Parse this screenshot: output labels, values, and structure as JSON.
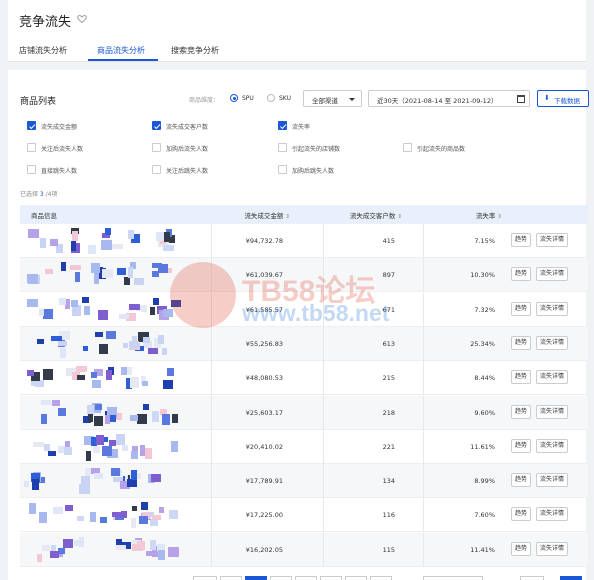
{
  "header": {
    "title": "竞争流失",
    "tabs": [
      {
        "label": "店铺流失分析",
        "active": false
      },
      {
        "label": "商品流失分析",
        "active": true
      },
      {
        "label": "搜索竞争分析",
        "active": false
      }
    ]
  },
  "list": {
    "title": "商品列表",
    "dimension_label": "商品维度：",
    "dimension_options": [
      {
        "label": "SPU",
        "selected": true
      },
      {
        "label": "SKU",
        "selected": false
      }
    ],
    "channel_select": "全部渠道",
    "date_range": "近30天（2021-08-14 至 2021-09-12）",
    "download_label": "下载数据"
  },
  "metrics": [
    {
      "label": "流失成交金额",
      "checked": true
    },
    {
      "label": "流失成交客户数",
      "checked": true
    },
    {
      "label": "流失率",
      "checked": true
    },
    {
      "label": "关注后流失人数",
      "checked": false
    },
    {
      "label": "加购后流失人数",
      "checked": false
    },
    {
      "label": "引起流失的店铺数",
      "checked": false
    },
    {
      "label": "引起流失的商品数",
      "checked": false
    },
    {
      "label": "直接跳失人数",
      "checked": false
    },
    {
      "label": "关注后跳失人数",
      "checked": false
    },
    {
      "label": "加购后跳失人数",
      "checked": false
    }
  ],
  "selected": {
    "prefix": "已选择 ",
    "count": "3",
    "suffix": " /4项"
  },
  "table": {
    "headers": [
      "商品信息",
      "流失成交金额",
      "流失成交客户数",
      "流失率"
    ],
    "rows": [
      {
        "amount": "¥94,732.78",
        "customers": "415",
        "rate": "7.15%"
      },
      {
        "amount": "¥61,039.67",
        "customers": "897",
        "rate": "10.30%"
      },
      {
        "amount": "¥61,585.57",
        "customers": "671",
        "rate": "7.32%"
      },
      {
        "amount": "¥55,256.83",
        "customers": "613",
        "rate": "25.34%"
      },
      {
        "amount": "¥48,080.53",
        "customers": "215",
        "rate": "8.44%"
      },
      {
        "amount": "¥25,603.17",
        "customers": "218",
        "rate": "9.60%"
      },
      {
        "amount": "¥20,410.02",
        "customers": "221",
        "rate": "11.61%"
      },
      {
        "amount": "¥17,789.91",
        "customers": "134",
        "rate": "8.99%"
      },
      {
        "amount": "¥17,225.00",
        "customers": "116",
        "rate": "7.60%"
      },
      {
        "amount": "¥16,202.05",
        "customers": "115",
        "rate": "11.41%"
      }
    ],
    "actions": {
      "trend": "趋势",
      "detail": "流失详情"
    }
  },
  "watermark": {
    "line1": "TB58论坛",
    "line2": "www.tb58.net"
  },
  "colors": {
    "accent": "#1a57d6",
    "header_bg": "#e9f0fb"
  }
}
